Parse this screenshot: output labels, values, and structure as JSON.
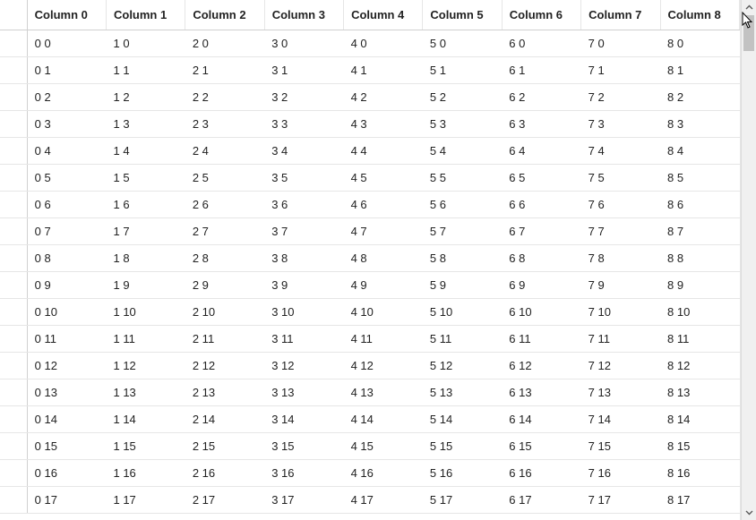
{
  "columns": [
    "Column 0",
    "Column 1",
    "Column 2",
    "Column 3",
    "Column 4",
    "Column 5",
    "Column 6",
    "Column 7",
    "Column 8"
  ],
  "rows": [
    [
      "0 0",
      "1 0",
      "2 0",
      "3 0",
      "4 0",
      "5 0",
      "6 0",
      "7 0",
      "8 0"
    ],
    [
      "0 1",
      "1 1",
      "2 1",
      "3 1",
      "4 1",
      "5 1",
      "6 1",
      "7 1",
      "8 1"
    ],
    [
      "0 2",
      "1 2",
      "2 2",
      "3 2",
      "4 2",
      "5 2",
      "6 2",
      "7 2",
      "8 2"
    ],
    [
      "0 3",
      "1 3",
      "2 3",
      "3 3",
      "4 3",
      "5 3",
      "6 3",
      "7 3",
      "8 3"
    ],
    [
      "0 4",
      "1 4",
      "2 4",
      "3 4",
      "4 4",
      "5 4",
      "6 4",
      "7 4",
      "8 4"
    ],
    [
      "0 5",
      "1 5",
      "2 5",
      "3 5",
      "4 5",
      "5 5",
      "6 5",
      "7 5",
      "8 5"
    ],
    [
      "0 6",
      "1 6",
      "2 6",
      "3 6",
      "4 6",
      "5 6",
      "6 6",
      "7 6",
      "8 6"
    ],
    [
      "0 7",
      "1 7",
      "2 7",
      "3 7",
      "4 7",
      "5 7",
      "6 7",
      "7 7",
      "8 7"
    ],
    [
      "0 8",
      "1 8",
      "2 8",
      "3 8",
      "4 8",
      "5 8",
      "6 8",
      "7 8",
      "8 8"
    ],
    [
      "0 9",
      "1 9",
      "2 9",
      "3 9",
      "4 9",
      "5 9",
      "6 9",
      "7 9",
      "8 9"
    ],
    [
      "0 10",
      "1 10",
      "2 10",
      "3 10",
      "4 10",
      "5 10",
      "6 10",
      "7 10",
      "8 10"
    ],
    [
      "0 11",
      "1 11",
      "2 11",
      "3 11",
      "4 11",
      "5 11",
      "6 11",
      "7 11",
      "8 11"
    ],
    [
      "0 12",
      "1 12",
      "2 12",
      "3 12",
      "4 12",
      "5 12",
      "6 12",
      "7 12",
      "8 12"
    ],
    [
      "0 13",
      "1 13",
      "2 13",
      "3 13",
      "4 13",
      "5 13",
      "6 13",
      "7 13",
      "8 13"
    ],
    [
      "0 14",
      "1 14",
      "2 14",
      "3 14",
      "4 14",
      "5 14",
      "6 14",
      "7 14",
      "8 14"
    ],
    [
      "0 15",
      "1 15",
      "2 15",
      "3 15",
      "4 15",
      "5 15",
      "6 15",
      "7 15",
      "8 15"
    ],
    [
      "0 16",
      "1 16",
      "2 16",
      "3 16",
      "4 16",
      "5 16",
      "6 16",
      "7 16",
      "8 16"
    ],
    [
      "0 17",
      "1 17",
      "2 17",
      "3 17",
      "4 17",
      "5 17",
      "6 17",
      "7 17",
      "8 17"
    ]
  ]
}
